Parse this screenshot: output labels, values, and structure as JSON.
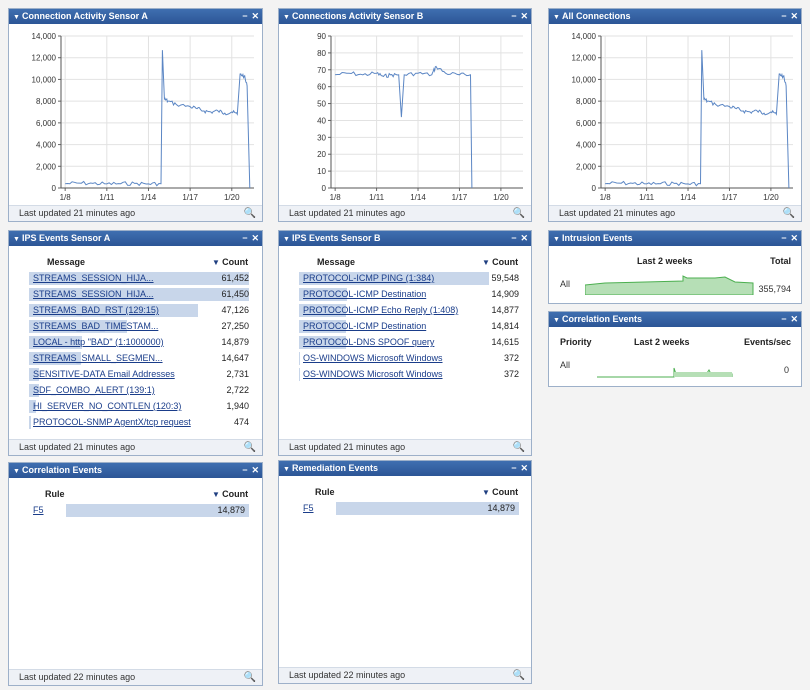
{
  "footer_icon": "magnifier-icon",
  "colors": {
    "header": "#2c5596",
    "line": "#5b86c4",
    "bar": "#c8d6ea",
    "spark": "#4caf50"
  },
  "w1": {
    "title": "Connection Activity Sensor A",
    "footer": "Last updated 21 minutes ago"
  },
  "w2": {
    "title": "Connections Activity Sensor B",
    "footer": "Last updated 21 minutes ago"
  },
  "w3": {
    "title": "All Connections",
    "footer": "Last updated 21 minutes ago"
  },
  "w4": {
    "title": "IPS Events Sensor A",
    "footer": "Last updated 21 minutes ago",
    "col_message": "Message",
    "col_count": "Count",
    "rows": [
      {
        "message": "STREAMS_SESSION_HIJA...",
        "count": "61,452"
      },
      {
        "message": "STREAMS_SESSION_HIJA...",
        "count": "61,450"
      },
      {
        "message": "STREAMS_BAD_RST (129:15)",
        "count": "47,126"
      },
      {
        "message": "STREAMS_BAD_TIMESTAM...",
        "count": "27,250"
      },
      {
        "message": "LOCAL - http \"BAD\" (1:1000000)",
        "count": "14,879"
      },
      {
        "message": "STREAMS_SMALL_SEGMEN...",
        "count": "14,647"
      },
      {
        "message": "SENSITIVE-DATA Email Addresses",
        "count": "2,731"
      },
      {
        "message": "SDF_COMBO_ALERT (139:1)",
        "count": "2,722"
      },
      {
        "message": "HI_SERVER_NO_CONTLEN (120:3)",
        "count": "1,940"
      },
      {
        "message": "PROTOCOL-SNMP AgentX/tcp request",
        "count": "474"
      }
    ]
  },
  "w5": {
    "title": "IPS Events Sensor B",
    "footer": "Last updated 21 minutes ago",
    "col_message": "Message",
    "col_count": "Count",
    "rows": [
      {
        "message": "PROTOCOL-ICMP PING (1:384)",
        "count": "59,548"
      },
      {
        "message": "PROTOCOL-ICMP Destination",
        "count": "14,909"
      },
      {
        "message": "PROTOCOL-ICMP Echo Reply (1:408)",
        "count": "14,877"
      },
      {
        "message": "PROTOCOL-ICMP Destination",
        "count": "14,814"
      },
      {
        "message": "PROTOCOL-DNS SPOOF query",
        "count": "14,615"
      },
      {
        "message": "OS-WINDOWS Microsoft Windows",
        "count": "372"
      },
      {
        "message": "OS-WINDOWS Microsoft Windows",
        "count": "372"
      }
    ]
  },
  "w6": {
    "title": "Intrusion Events",
    "col_range": "Last 2 weeks",
    "col_total": "Total",
    "row_label": "All",
    "row_value": "355,794"
  },
  "w7": {
    "title": "Correlation Events",
    "col_priority": "Priority",
    "col_range": "Last 2 weeks",
    "col_rate": "Events/sec",
    "row_label": "All",
    "row_value": "0"
  },
  "w8": {
    "title": "Correlation Events",
    "footer": "Last updated 22 minutes ago",
    "col_rule": "Rule",
    "col_count": "Count",
    "rows": [
      {
        "rule": "F5",
        "count": "14,879"
      }
    ]
  },
  "w9": {
    "title": "Remediation Events",
    "footer": "Last updated 22 minutes ago",
    "col_rule": "Rule",
    "col_count": "Count",
    "rows": [
      {
        "rule": "F5",
        "count": "14,879"
      }
    ]
  },
  "chart_data": [
    {
      "type": "line",
      "title": "Connection Activity Sensor A",
      "categories": [
        "1/8",
        "1/11",
        "1/14",
        "1/17",
        "1/20"
      ],
      "ylim": [
        0,
        14000
      ],
      "yticks": [
        "0",
        "2,000",
        "4,000",
        "6,000",
        "8,000",
        "10,000",
        "12,000",
        "14,000"
      ],
      "x": [
        8,
        9,
        10,
        11,
        12,
        13,
        14,
        14.9,
        15.0,
        15.15,
        15.4,
        16,
        17,
        17.5,
        18,
        18.5,
        19,
        19.5,
        20,
        20.4,
        20.6,
        20.9,
        21.1,
        21.3
      ],
      "values": [
        400,
        450,
        420,
        380,
        400,
        420,
        380,
        400,
        12700,
        8200,
        8000,
        7700,
        7500,
        7300,
        7100,
        7000,
        7100,
        6900,
        7000,
        6800,
        10500,
        10300,
        9400,
        0
      ]
    },
    {
      "type": "line",
      "title": "Connections Activity Sensor B",
      "categories": [
        "1/8",
        "1/11",
        "1/14",
        "1/17",
        "1/20"
      ],
      "ylim": [
        0,
        90
      ],
      "yticks": [
        "0",
        "10",
        "20",
        "30",
        "40",
        "50",
        "60",
        "70",
        "80",
        "90"
      ],
      "x": [
        8,
        9,
        10,
        11,
        11.5,
        12,
        12.6,
        12.8,
        13,
        14,
        15,
        15.3,
        16,
        17,
        17.8,
        17.9
      ],
      "values": [
        67,
        68,
        67,
        68,
        66,
        67,
        67,
        42,
        67,
        68,
        67,
        72,
        68,
        67,
        67,
        0
      ]
    },
    {
      "type": "line",
      "title": "All Connections",
      "categories": [
        "1/8",
        "1/11",
        "1/14",
        "1/17",
        "1/20"
      ],
      "ylim": [
        0,
        14000
      ],
      "yticks": [
        "0",
        "2,000",
        "4,000",
        "6,000",
        "8,000",
        "10,000",
        "12,000",
        "14,000"
      ],
      "x": [
        8,
        9,
        10,
        11,
        12,
        13,
        14,
        14.9,
        15.0,
        15.15,
        15.4,
        16,
        17,
        17.5,
        18,
        18.5,
        19,
        19.5,
        20,
        20.4,
        20.6,
        20.9,
        21.1,
        21.3
      ],
      "values": [
        400,
        450,
        420,
        380,
        400,
        420,
        380,
        400,
        12700,
        8200,
        8000,
        7700,
        7500,
        7300,
        7100,
        7000,
        7100,
        6900,
        7000,
        6800,
        10500,
        10300,
        9400,
        0
      ]
    }
  ]
}
